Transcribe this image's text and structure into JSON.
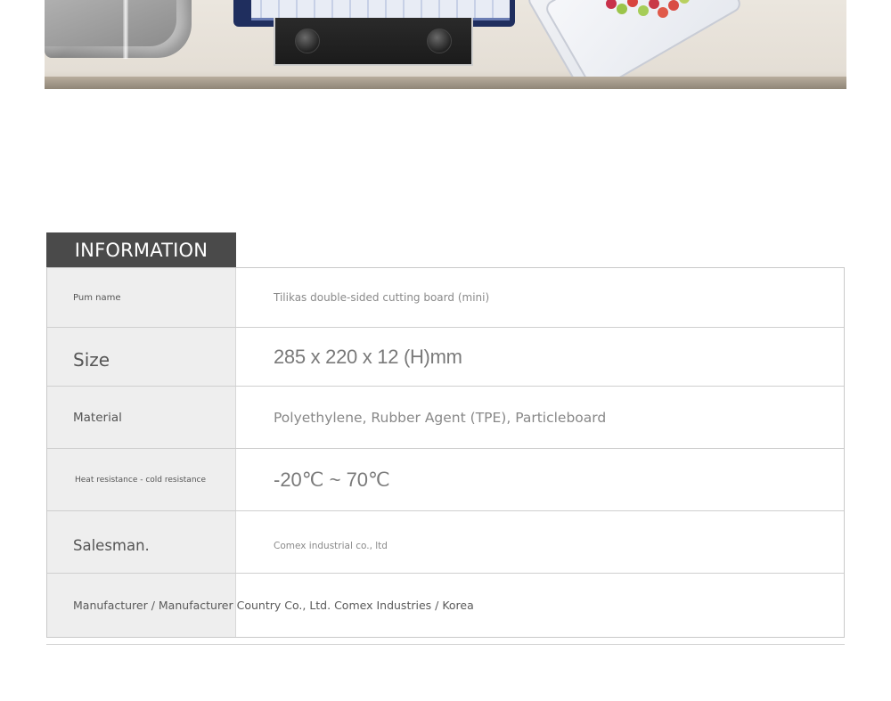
{
  "section": {
    "tab_label": "INFORMATION"
  },
  "info": {
    "rows": [
      {
        "label": "Pum name",
        "value": "Tilikas double-sided cutting board (mini)"
      },
      {
        "label": "Size",
        "value": "285 x 220 x 12 (H)mm"
      },
      {
        "label": "Material",
        "value": "Polyethylene, Rubber Agent (TPE), Particleboard"
      },
      {
        "label": "Heat resistance - cold resistance",
        "value": "-20℃ ~ 70℃"
      },
      {
        "label": "Salesman.",
        "value": "Comex industrial co., ltd"
      },
      {
        "label": "Manufacturer / Manufacturer Country Co., Ltd. Comex Industries / Korea",
        "value": ""
      }
    ]
  },
  "colors": {
    "tab_background": "#4a4a4a",
    "label_background": "#eeeeee",
    "border": "#c9c9c9"
  }
}
